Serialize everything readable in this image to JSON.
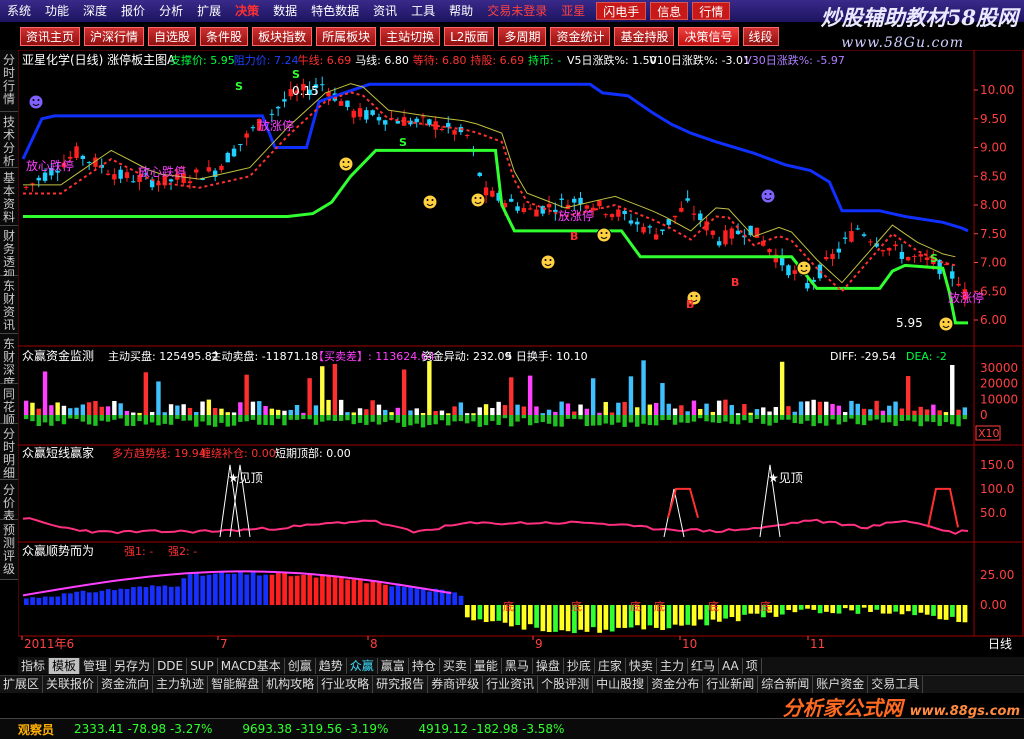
{
  "menu": {
    "items": [
      "系统",
      "功能",
      "深度",
      "报价",
      "分析",
      "扩展",
      "决策",
      "数据",
      "特色数据",
      "资讯",
      "工具",
      "帮助"
    ],
    "active": "决策",
    "login": "交易未登录",
    "login2": "亚星",
    "buttons": [
      "闪电手",
      "信息",
      "行情"
    ]
  },
  "watermark": {
    "text": "炒股辅助教材58股网",
    "url": "www.58Gu.com"
  },
  "toolbar": [
    "资讯主页",
    "沪深行情",
    "自选股",
    "条件股",
    "板块指数",
    "所属板块",
    "主站切换",
    "L2版面",
    "多周期",
    "资金统计",
    "基金持股",
    "决策信号",
    "线段"
  ],
  "left_tabs": [
    "分时行情",
    "技术分析",
    "基本资料",
    "财务透视",
    "东财资讯",
    "东财深度",
    "同花顺",
    "分时明细",
    "分价表",
    "预测评级"
  ],
  "panel1": {
    "title": "亚星化学(日线) 涨停板主图A",
    "legend": [
      {
        "t": "支撑价: 5.95",
        "c": "#00ff40"
      },
      {
        "t": "阻力价: 7.24",
        "c": "#2040ff"
      },
      {
        "t": "牛线: 6.69",
        "c": "#ff3030"
      },
      {
        "t": "马线: 6.80",
        "c": "#ffffff"
      },
      {
        "t": "等待: 6.80",
        "c": "#ff3030"
      },
      {
        "t": "持股: 6.69",
        "c": "#ff3030"
      },
      {
        "t": "持币: -",
        "c": "#00ff40"
      },
      {
        "t": "V5日涨跌%: 1.50",
        "c": "#ffffff"
      },
      {
        "t": "V10日涨跌%: -3.01",
        "c": "#ffffff"
      },
      {
        "t": "V30日涨跌%: -5.97",
        "c": "#b080ff"
      }
    ],
    "yticks": [
      "10.00",
      "9.50",
      "9.00",
      "8.50",
      "8.00",
      "7.50",
      "7.00",
      "6.50",
      "6.00"
    ],
    "annotations": [
      "0.15",
      "放心跌停",
      "放心跌停",
      "放涨停",
      "放涨停",
      "放涨停",
      "5.95"
    ]
  },
  "panel2": {
    "title": "众赢资金监测",
    "legend": [
      {
        "t": "主动买盘: 125495.82",
        "c": "#ffffff"
      },
      {
        "t": "主动卖盘: -11871.18",
        "c": "#ffffff"
      },
      {
        "t": "【买卖差】: 113624.64",
        "c": "#ff40ff"
      },
      {
        "t": "资金异动: 232.09",
        "c": "#ffffff"
      },
      {
        "t": "5 日换手: 10.10",
        "c": "#ffffff"
      }
    ],
    "right": [
      {
        "t": "DIFF: -29.54",
        "c": "#ffffff"
      },
      {
        "t": "DEA: -2",
        "c": "#00ff40"
      }
    ],
    "yticks": [
      "30000",
      "20000",
      "10000",
      "0"
    ],
    "unit": "X10"
  },
  "panel3": {
    "title": "众赢短线赢家",
    "legend": [
      {
        "t": "多方趋势线: 19.94",
        "c": "#ff3030"
      },
      {
        "t": "缠绕补仓: 0.00",
        "c": "#ff3030"
      },
      {
        "t": "短期顶部: 0.00",
        "c": "#ffffff"
      }
    ],
    "yticks": [
      "150.0",
      "100.0",
      "50.0"
    ],
    "annotations": [
      "见顶",
      "见顶"
    ]
  },
  "panel4": {
    "title": "众赢顺势而为",
    "legend": [
      {
        "t": "强1: -",
        "c": "#ff3030"
      },
      {
        "t": "强2: -",
        "c": "#ff3030"
      }
    ],
    "yticks": [
      "25.00",
      "0.00"
    ],
    "annotations": [
      "底",
      "底",
      "底",
      "底",
      "底",
      "底"
    ]
  },
  "xaxis": {
    "labels": [
      "2011年6",
      "7",
      "8",
      "9",
      "10",
      "11"
    ],
    "period": "日线"
  },
  "bottom_tabs": [
    "指标",
    "模板",
    "管理",
    "另存为",
    "DDE",
    "SUP",
    "MACD基本",
    "创赢",
    "趋势",
    "众赢",
    "赢富",
    "持仓",
    "买卖",
    "量能",
    "黑马",
    "操盘",
    "抄底",
    "庄家",
    "快卖",
    "主力",
    "红马",
    "AA",
    "项"
  ],
  "bottom_active": "模板",
  "bottom_cyan": "众赢",
  "sec_tabs": [
    "扩展区",
    "关联报价",
    "资金流向",
    "主力轨迹",
    "智能解盘",
    "机构攻略",
    "行业攻略",
    "研究报告",
    "券商评级",
    "行业资讯",
    "个股评测",
    "中山股搜",
    "资金分布",
    "行业新闻",
    "综合新闻",
    "账户资金",
    "交易工具"
  ],
  "ticker": {
    "label": "观察员",
    "items": [
      {
        "t": "2333.41   -78.98   -3.27%",
        "c": "#30ff30"
      },
      {
        "t": "9693.38   -319.56   -3.19%",
        "c": "#30ff30"
      },
      {
        "t": "4919.12   -182.98   -3.58%",
        "c": "#30ff30"
      }
    ]
  },
  "brand": {
    "name": "分析家公式网",
    "url": "www.88gs.com"
  }
}
